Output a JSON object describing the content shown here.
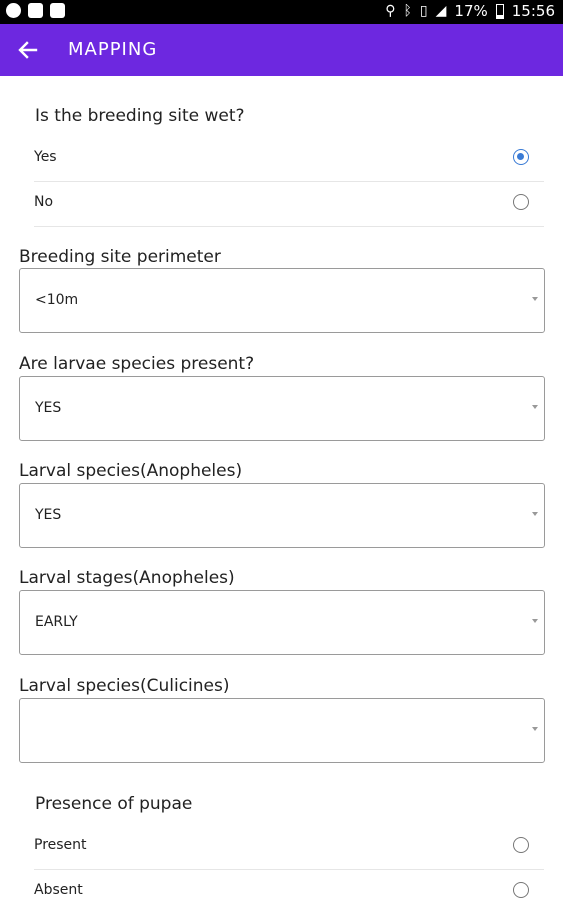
{
  "status_bar": {
    "battery": "17%",
    "time": "15:56",
    "icons": [
      "whatsapp-icon",
      "gallery-icon",
      "mail-icon",
      "location-icon",
      "bluetooth-icon",
      "vibrate-icon",
      "signal-icon",
      "battery-icon"
    ]
  },
  "toolbar": {
    "title": "MAPPING",
    "back_icon": "arrow-left-icon",
    "color": "#6d28e0"
  },
  "form": {
    "wet_question": {
      "label": "Is the breeding site wet?",
      "options": [
        {
          "label": "Yes",
          "selected": true
        },
        {
          "label": "No",
          "selected": false
        }
      ]
    },
    "perimeter": {
      "label": "Breeding site perimeter",
      "value": "<10m"
    },
    "larvae_present": {
      "label": "Are larvae species present?",
      "value": "YES"
    },
    "larval_species_anopheles": {
      "label": "Larval species(Anopheles)",
      "value": "YES"
    },
    "larval_stages_anopheles": {
      "label": "Larval stages(Anopheles)",
      "value": "EARLY"
    },
    "larval_species_culicines": {
      "label": "Larval species(Culicines)",
      "value": ""
    },
    "pupae_question": {
      "label": "Presence of pupae",
      "options": [
        {
          "label": "Present",
          "selected": false
        },
        {
          "label": "Absent",
          "selected": false
        }
      ]
    }
  },
  "colors": {
    "accent_radio": "#3a7bd5"
  }
}
